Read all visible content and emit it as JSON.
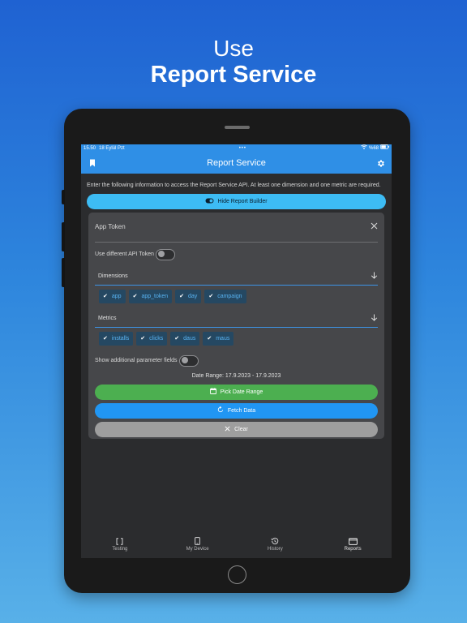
{
  "promo": {
    "line1": "Use",
    "line2": "Report Service"
  },
  "status": {
    "time": "15.50",
    "date": "18 Eylül Pzt",
    "center": "•••",
    "battery": "%68"
  },
  "appbar": {
    "title": "Report Service",
    "left_icon": "bookmark-icon",
    "right_icon": "gear-icon"
  },
  "intro": "Enter the following information to access the Report Service API. At least one dimension and one metric are required.",
  "hide_button": {
    "label": "Hide Report Builder",
    "icon": "toggle-icon"
  },
  "app_token": {
    "placeholder": "App Token"
  },
  "use_different_token": {
    "label": "Use different API Token",
    "on": false
  },
  "dimensions": {
    "label": "Dimensions",
    "chips": [
      "app",
      "app_token",
      "day",
      "campaign"
    ]
  },
  "metrics": {
    "label": "Metrics",
    "chips": [
      "installs",
      "clicks",
      "daus",
      "maus"
    ]
  },
  "additional_params": {
    "label": "Show additional parameter fields",
    "on": false
  },
  "date_range": "Date Range: 17.9.2023 - 17.9.2023",
  "buttons": {
    "pick_date": "Pick Date Range",
    "fetch": "Fetch Data",
    "clear": "Clear"
  },
  "tabs": [
    {
      "label": "Testing",
      "icon": "bracket-icon",
      "active": false
    },
    {
      "label": "My Device",
      "icon": "phone-icon",
      "active": false
    },
    {
      "label": "History",
      "icon": "history-icon",
      "active": false
    },
    {
      "label": "Reports",
      "icon": "folder-icon",
      "active": true
    }
  ],
  "colors": {
    "accent": "#2f8fe6",
    "hide_button": "#3dbcf4",
    "pick_date": "#4caf50",
    "fetch": "#2196f3",
    "clear": "#9e9e9e"
  }
}
